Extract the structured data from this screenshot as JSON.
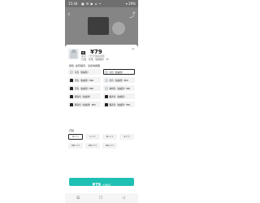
{
  "status_bar": {
    "time": "15:44",
    "indicators": "▣ ✉ ▶ ⌂ •",
    "right": "▾ 29%"
  },
  "backdrop": {
    "back_icon": "‹",
    "share_icon": "⤴"
  },
  "product": {
    "coupon_label": "券",
    "price": "¥79",
    "subtitle": "库存 · 7天无理由退换",
    "selected_text": "已选 · 灰色（加绒款） M",
    "close_icon": "✕"
  },
  "color_section": {
    "label": "颜色",
    "note": "·如有疑问，请咨询客服"
  },
  "colors": [
    {
      "label": "灰色（加绒款）",
      "tone": "light",
      "selected": false
    },
    {
      "label": "灰色（加绒款）",
      "tone": "light",
      "selected": true
    },
    {
      "label": "黑色（加绒款）860",
      "tone": "dark",
      "selected": false
    },
    {
      "label": "灰色（加绒款）860",
      "tone": "light",
      "selected": false
    },
    {
      "label": "黑色（加绒款）860",
      "tone": "dark",
      "selected": false
    },
    {
      "label": "咖啡色（加绒款）860",
      "tone": "light",
      "selected": false
    },
    {
      "label": "藏青色（加绒款）",
      "tone": "dark",
      "selected": false
    },
    {
      "label": "藏青色（加绒款）",
      "tone": "dark",
      "selected": false
    },
    {
      "label": "藏青色（加绒款）860",
      "tone": "dark",
      "selected": false
    },
    {
      "label": "藏青色（加绒款）860",
      "tone": "dark",
      "selected": false
    }
  ],
  "size_section": {
    "label": "尺码"
  },
  "sizes": [
    {
      "label": "M",
      "price": "¥79",
      "selected": true
    },
    {
      "label": "L",
      "price": "¥79",
      "selected": false
    },
    {
      "label": "XL",
      "price": "¥79",
      "selected": false
    },
    {
      "label": "S",
      "price": "¥79",
      "selected": false
    },
    {
      "label": "3XL",
      "price": "¥79",
      "selected": false
    },
    {
      "label": "2XL",
      "price": "¥79",
      "selected": false
    },
    {
      "label": "4XL",
      "price": "¥79",
      "selected": false
    }
  ],
  "buy_button": {
    "amount": "¥79",
    "sub": "立即购买"
  },
  "navbar": {
    "menu": "☰",
    "home": "☐",
    "back": "◁"
  },
  "colors_theme": {
    "accent": "#1ec0b3",
    "text": "#111111"
  }
}
